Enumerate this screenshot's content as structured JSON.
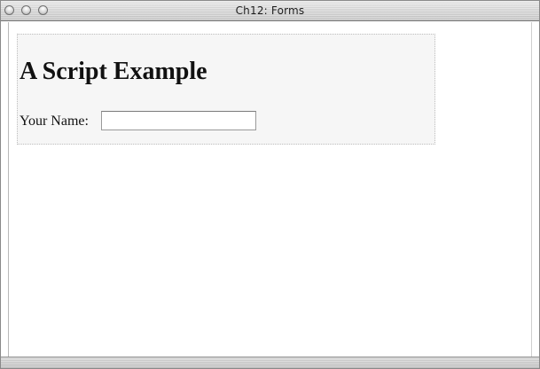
{
  "window": {
    "title": "Ch12: Forms",
    "controls": {
      "close_icon": "close-icon",
      "minimize_icon": "minimize-icon",
      "zoom_icon": "zoom-icon"
    }
  },
  "page": {
    "heading": "A Script Example",
    "form": {
      "name_label": "Your Name:",
      "name_value": "",
      "name_placeholder": ""
    }
  },
  "colors": {
    "window_background": "#ffffff",
    "example_box_background": "#f6f6f6",
    "example_box_border": "#bdbdbd",
    "titlebar": "#d6d6d6",
    "text": "#111111"
  }
}
